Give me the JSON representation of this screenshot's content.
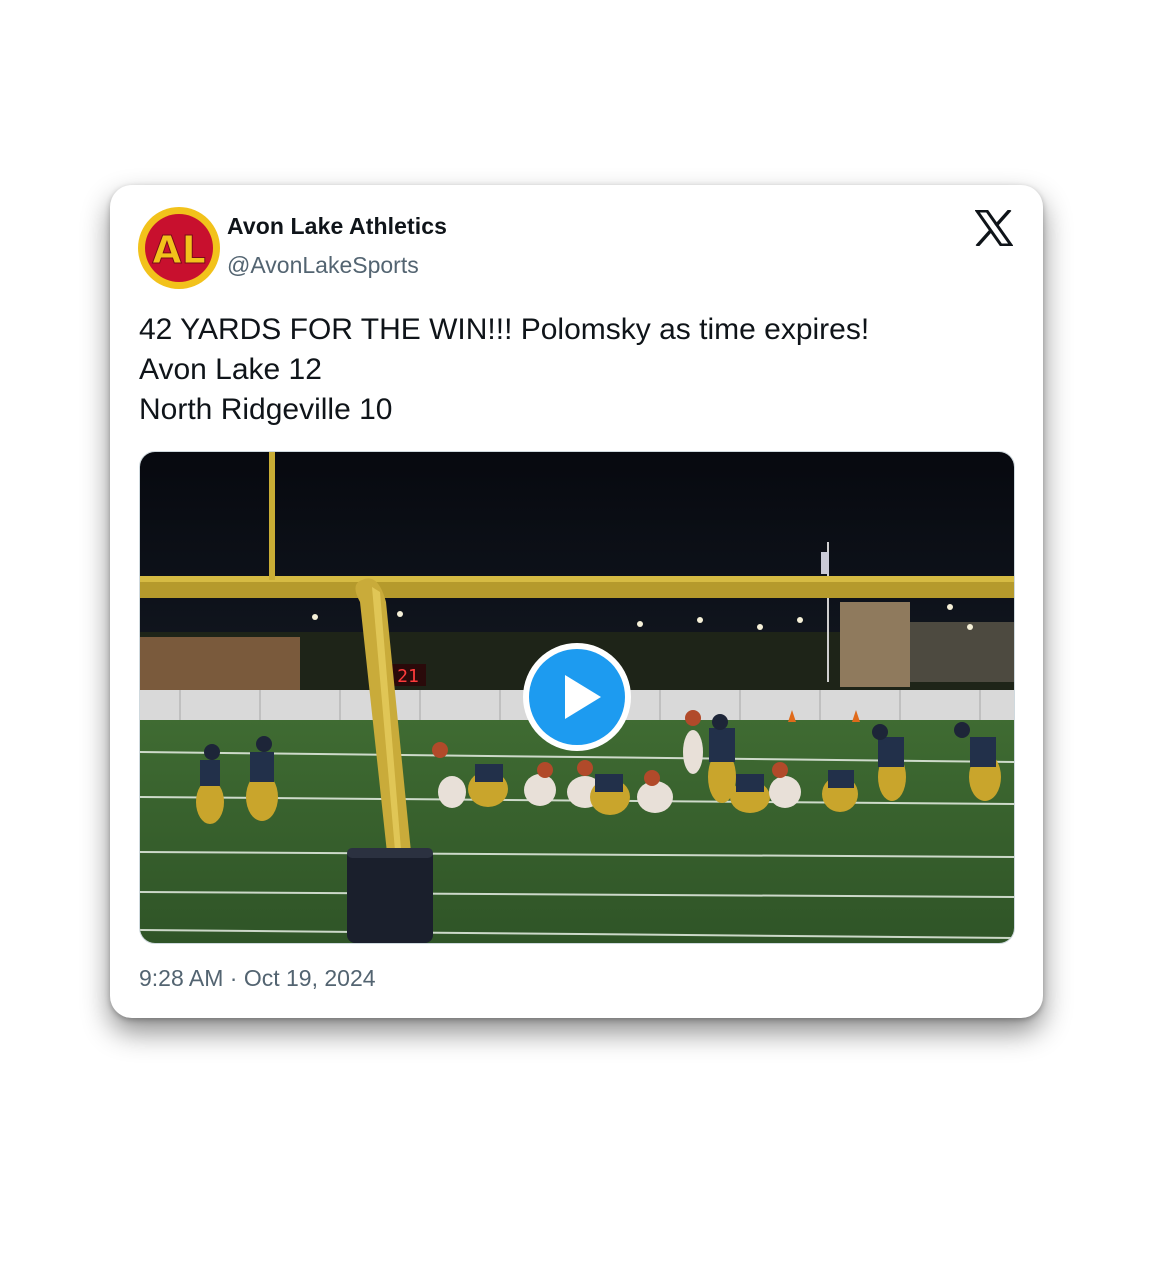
{
  "account": {
    "display_name": "Avon Lake Athletics",
    "handle": "@AvonLakeSports",
    "avatar_letters": "AL",
    "avatar_colors": {
      "ring": "#f2c21b",
      "background": "#c8102e",
      "text": "#f2c21b"
    }
  },
  "platform": {
    "logo": "x-logo-icon"
  },
  "tweet": {
    "lines": [
      "42 YARDS FOR THE WIN!!! Polomsky as time expires!",
      "Avon Lake 12",
      "North Ridgeville 10"
    ]
  },
  "media": {
    "type": "video",
    "play_icon": "play-icon",
    "play_color": "#1d9bf0",
    "scoreboard_text": "21"
  },
  "footer": {
    "timestamp": "9:28 AM · Oct 19, 2024"
  },
  "colors": {
    "text_primary": "#0f1419",
    "text_secondary": "#536471"
  }
}
